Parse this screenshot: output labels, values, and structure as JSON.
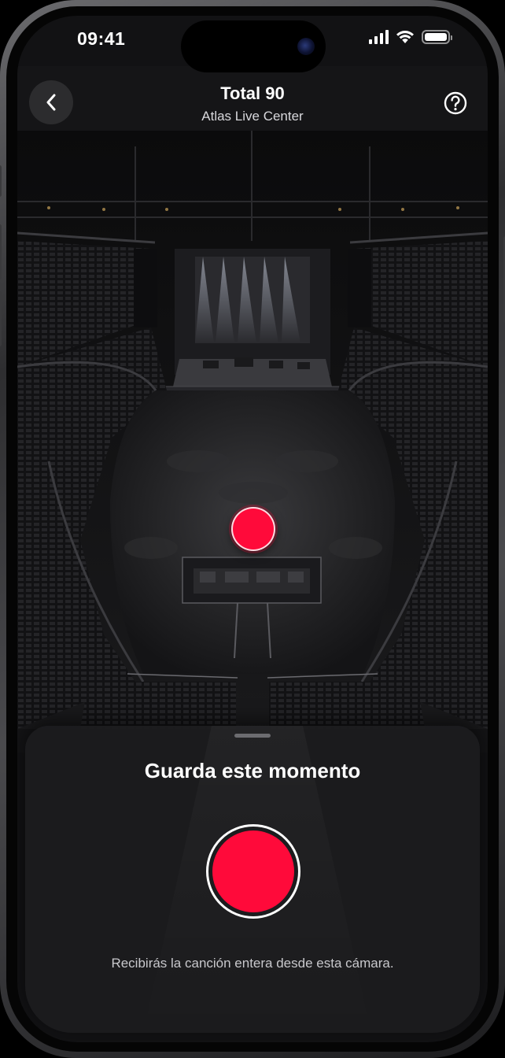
{
  "status_bar": {
    "time": "09:41",
    "icons": [
      "cellular-signal-icon",
      "wifi-icon",
      "battery-icon"
    ],
    "battery_level": 1.0
  },
  "nav": {
    "title": "Total 90",
    "subtitle": "Atlas Live Center",
    "back_icon": "chevron-left-icon",
    "help_icon": "question-circle-icon"
  },
  "arena": {
    "marker_color": "#ff0a3a"
  },
  "sheet": {
    "title": "Guarda este momento",
    "caption": "Recibirás la canción entera desde esta cámara.",
    "record_color": "#ff0a3a"
  },
  "colors": {
    "accent": "#ff0a3a",
    "background": "#121214",
    "sheet": "#1c1c1e"
  }
}
